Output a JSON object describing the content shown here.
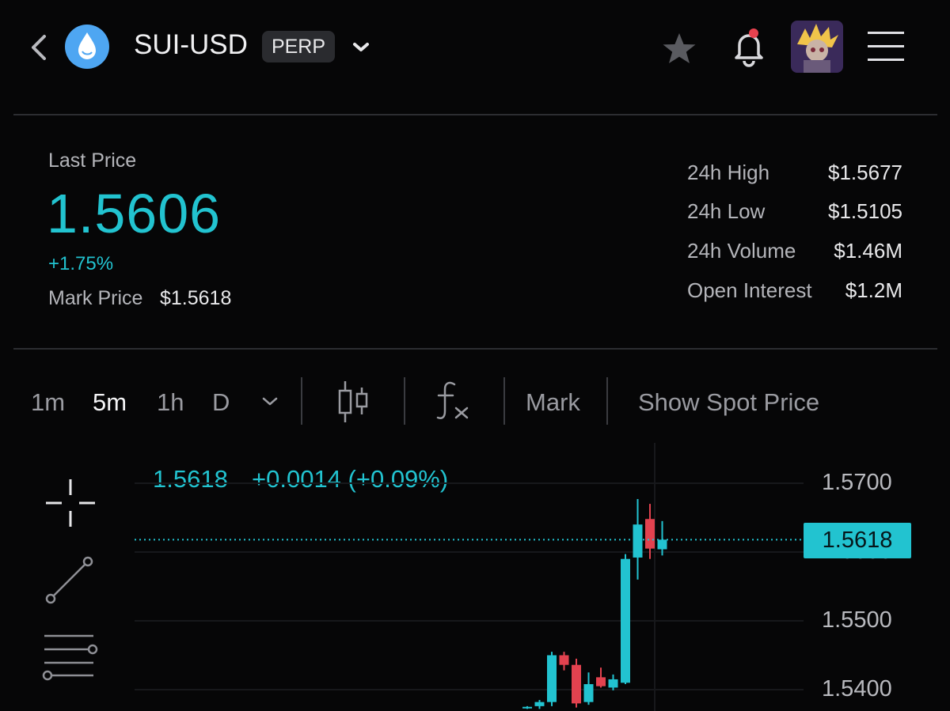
{
  "header": {
    "symbol": "SUI-USD",
    "badge": "PERP",
    "icons": {
      "back": "chevron-left-icon",
      "coin": "sui-logo-icon",
      "dropdown": "chevron-down-icon",
      "favorite": "star-icon",
      "notifications": "bell-icon",
      "avatar": "avatar",
      "menu": "hamburger-menu-icon"
    },
    "notification_dot_color": "#e8424f"
  },
  "summary": {
    "last_price_label": "Last Price",
    "last_price": "1.5606",
    "change_pct": "+1.75%",
    "mark_price_label": "Mark Price",
    "mark_price": "$1.5618",
    "stats": [
      {
        "label": "24h High",
        "value": "$1.5677"
      },
      {
        "label": "24h Low",
        "value": "$1.5105"
      },
      {
        "label": "24h Volume",
        "value": "$1.46M"
      },
      {
        "label": "Open Interest",
        "value": "$1.2M"
      }
    ],
    "accent_color": "#22c3d0"
  },
  "toolbar": {
    "timeframes": [
      "1m",
      "5m",
      "1h",
      "D"
    ],
    "active_timeframe": "5m",
    "mark_label": "Mark",
    "spot_label": "Show Spot Price",
    "icons": {
      "more": "chevron-down-icon",
      "candles": "candlestick-icon",
      "indicators": "function-fx-icon"
    }
  },
  "chart_data": {
    "type": "candlestick",
    "info_price": "1.5618",
    "info_change": "+0.0014 (+0.09%)",
    "y_ticks": [
      "1.5700",
      "1.5600",
      "1.5500",
      "1.5400"
    ],
    "ylim": [
      1.5374,
      1.574
    ],
    "current_price_label": "1.5618",
    "current_price": 1.5618,
    "up_color": "#22c3d0",
    "down_color": "#e2424f",
    "candles": [
      {
        "o": 1.5374,
        "h": 1.5376,
        "l": 1.5372,
        "c": 1.5375
      },
      {
        "o": 1.5376,
        "h": 1.5385,
        "l": 1.5372,
        "c": 1.5382
      },
      {
        "o": 1.5382,
        "h": 1.5455,
        "l": 1.5376,
        "c": 1.545
      },
      {
        "o": 1.545,
        "h": 1.5455,
        "l": 1.5428,
        "c": 1.5436
      },
      {
        "o": 1.5436,
        "h": 1.5445,
        "l": 1.5374,
        "c": 1.538
      },
      {
        "o": 1.5382,
        "h": 1.5425,
        "l": 1.5378,
        "c": 1.5408
      },
      {
        "o": 1.5418,
        "h": 1.5432,
        "l": 1.5403,
        "c": 1.5405
      },
      {
        "o": 1.5403,
        "h": 1.5422,
        "l": 1.5399,
        "c": 1.5415
      },
      {
        "o": 1.541,
        "h": 1.5597,
        "l": 1.5408,
        "c": 1.559
      },
      {
        "o": 1.5592,
        "h": 1.5677,
        "l": 1.556,
        "c": 1.564
      },
      {
        "o": 1.5648,
        "h": 1.567,
        "l": 1.559,
        "c": 1.5605
      },
      {
        "o": 1.5604,
        "h": 1.5645,
        "l": 1.5595,
        "c": 1.5618
      }
    ]
  },
  "drawing_tools": [
    "crosshair-icon",
    "trend-line-icon",
    "horizontal-lines-icon"
  ]
}
